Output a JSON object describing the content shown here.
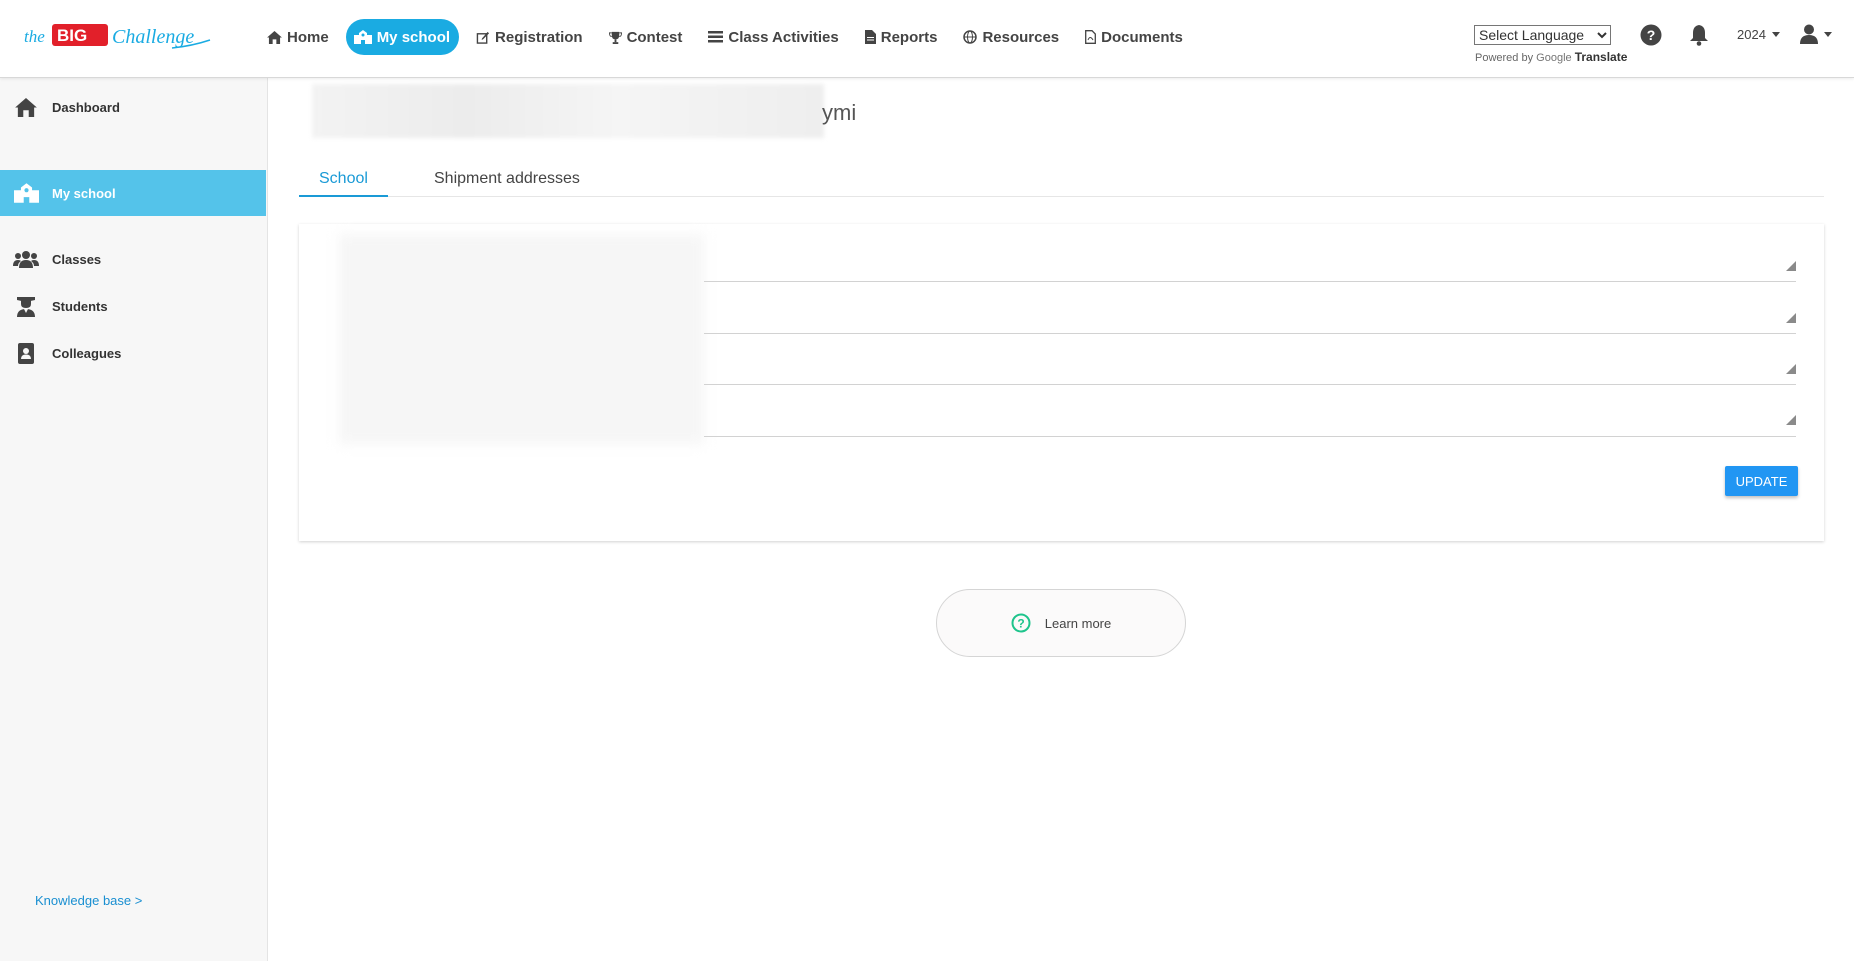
{
  "header": {
    "logo": "the BIG Challenge",
    "nav": [
      {
        "label": "Home",
        "icon": "home-icon"
      },
      {
        "label": "My school",
        "icon": "school-icon"
      },
      {
        "label": "Registration",
        "icon": "edit-icon"
      },
      {
        "label": "Contest",
        "icon": "trophy-icon"
      },
      {
        "label": "Class Activities",
        "icon": "list-icon"
      },
      {
        "label": "Reports",
        "icon": "document-icon"
      },
      {
        "label": "Resources",
        "icon": "globe-icon"
      },
      {
        "label": "Documents",
        "icon": "pdf-icon"
      }
    ],
    "language_select": "Select Language",
    "powered_by": "Powered by",
    "google": "Google",
    "translate": "Translate",
    "year": "2024"
  },
  "sidebar": {
    "items": [
      {
        "label": "Dashboard",
        "icon": "home-icon"
      },
      {
        "label": "My school",
        "icon": "school-icon"
      },
      {
        "label": "Classes",
        "icon": "users-icon"
      },
      {
        "label": "Students",
        "icon": "graduate-icon"
      },
      {
        "label": "Colleagues",
        "icon": "address-book-icon"
      }
    ],
    "knowledge_base": "Knowledge base >"
  },
  "main": {
    "title_visible_tail": "ymi",
    "tabs": [
      {
        "label": "School"
      },
      {
        "label": "Shipment addresses"
      }
    ],
    "update_button": "UPDATE",
    "learn_more": "Learn more"
  },
  "colors": {
    "brand_blue": "#1aabe2",
    "sidebar_active": "#54c3ea",
    "tab_active": "#1a9ad6",
    "update_button": "#2196f3",
    "learn_icon": "#1ec48c"
  }
}
